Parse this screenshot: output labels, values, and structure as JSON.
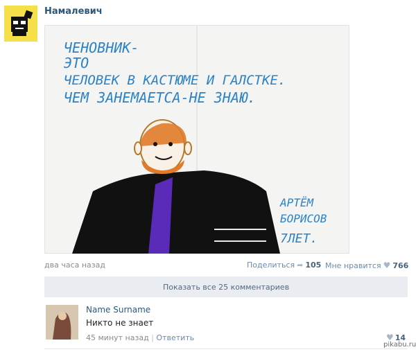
{
  "post": {
    "author": "Намалевич",
    "time": "два часа назад",
    "share_label": "Поделиться",
    "share_count": "105",
    "like_label": "Мне нравится",
    "like_count": "766"
  },
  "drawing": {
    "line1": "ЧЕНОВНИК-",
    "line2": "ЭТО",
    "line3": "ЧЕЛОВЕК В КАСТЮМЕ И ГАЛСТКЕ.",
    "line4": "ЧЕМ ЗАНЕМАЕТСА-НЕ ЗНАЮ.",
    "sign1": "АРТЁМ",
    "sign2": "БОРИСОВ",
    "sign3": "7ЛЕТ."
  },
  "comments": {
    "show_all": "Показать все 25 комментариев",
    "items": [
      {
        "name": "Name Surname",
        "text": "Никто не знает",
        "time": "45 минут назад",
        "reply": "Ответить",
        "likes": "14"
      }
    ]
  },
  "watermark": "pikabu.ru",
  "colors": {
    "link": "#2b587a",
    "accent_blue_ink": "#2a82c8",
    "avatar_yellow": "#f6e04a"
  }
}
